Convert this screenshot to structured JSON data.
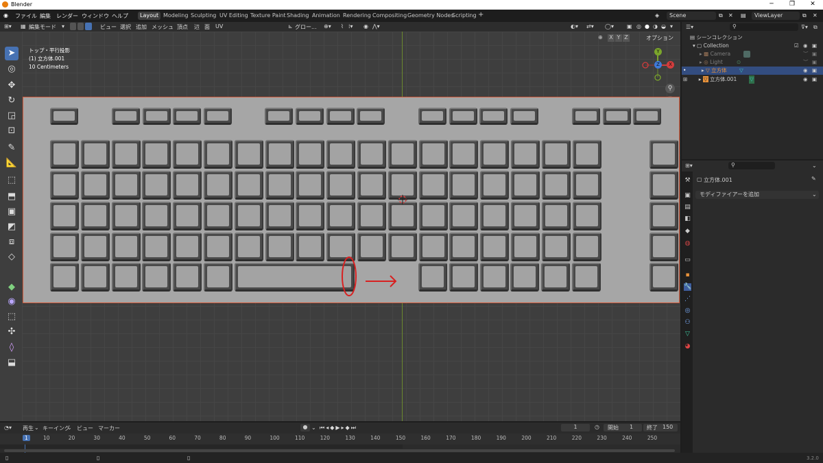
{
  "window": {
    "title": "Blender"
  },
  "menus": [
    "ファイル",
    "編集",
    "レンダー",
    "ウィンドウ",
    "ヘルプ"
  ],
  "workspaces": [
    "Layout",
    "Modeling",
    "Sculpting",
    "UV Editing",
    "Texture Paint",
    "Shading",
    "Animation",
    "Rendering",
    "Compositing",
    "Geometry Nodes",
    "Scripting"
  ],
  "scene": {
    "label": "Scene",
    "viewlayer": "ViewLayer"
  },
  "viewport_header": {
    "mode": "編集モード",
    "menus": [
      "ビュー",
      "選択",
      "追加",
      "メッシュ",
      "頂点",
      "辺",
      "面",
      "UV"
    ],
    "orientation": "グロー...",
    "options": "オプション",
    "axes": [
      "X",
      "Y",
      "Z"
    ]
  },
  "overlay": {
    "view": "トップ・平行投影",
    "object": "(1) 立方体.001",
    "scale": "10 Centimeters"
  },
  "gizmo": {
    "x": "X",
    "y": "Y",
    "z": "Z"
  },
  "outliner": {
    "title": "シーンコレクション",
    "rows": [
      "Collection",
      "Camera",
      "Light",
      "立方体",
      "立方体.001"
    ]
  },
  "properties": {
    "object": "立方体.001",
    "modifier_add": "モディファイアーを追加"
  },
  "timeline": {
    "menus": [
      "再生",
      "キーイング",
      "ビュー",
      "マーカー"
    ],
    "current_frame": "1",
    "start_label": "開始",
    "start": "1",
    "end_label": "終了",
    "end": "150",
    "ticks": [
      "1",
      "10",
      "20",
      "30",
      "40",
      "50",
      "60",
      "70",
      "80",
      "90",
      "100",
      "110",
      "120",
      "130",
      "140",
      "150",
      "160",
      "170",
      "180",
      "190",
      "200",
      "210",
      "220",
      "230",
      "240",
      "250"
    ]
  },
  "status": {
    "version": "3.2.0"
  },
  "colors": {
    "accent": "#4772b3",
    "selection": "#d35a3a",
    "annotation": "#d82020"
  }
}
